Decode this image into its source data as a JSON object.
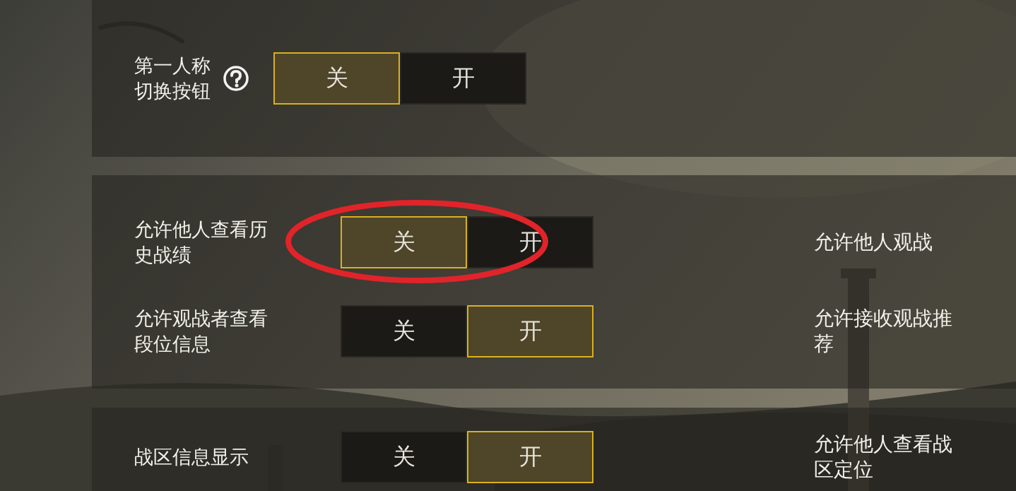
{
  "sections": [
    {
      "rows": [
        {
          "label": "第一人称切换按钮",
          "help": true,
          "options": [
            {
              "label": "关",
              "selected": true
            },
            {
              "label": "开",
              "selected": false
            }
          ]
        }
      ]
    },
    {
      "rows": [
        {
          "label": "允许他人查看历史战绩",
          "options": [
            {
              "label": "关",
              "selected": true
            },
            {
              "label": "开",
              "selected": false
            }
          ],
          "side_label": "允许他人观战"
        },
        {
          "label": "允许观战者查看段位信息",
          "options": [
            {
              "label": "关",
              "selected": false
            },
            {
              "label": "开",
              "selected": true
            }
          ],
          "side_label": "允许接收观战推荐"
        }
      ]
    },
    {
      "rows": [
        {
          "label": "战区信息显示",
          "options": [
            {
              "label": "关",
              "selected": false
            },
            {
              "label": "开",
              "selected": true
            }
          ],
          "side_label": "允许他人查看战区定位"
        }
      ]
    }
  ]
}
